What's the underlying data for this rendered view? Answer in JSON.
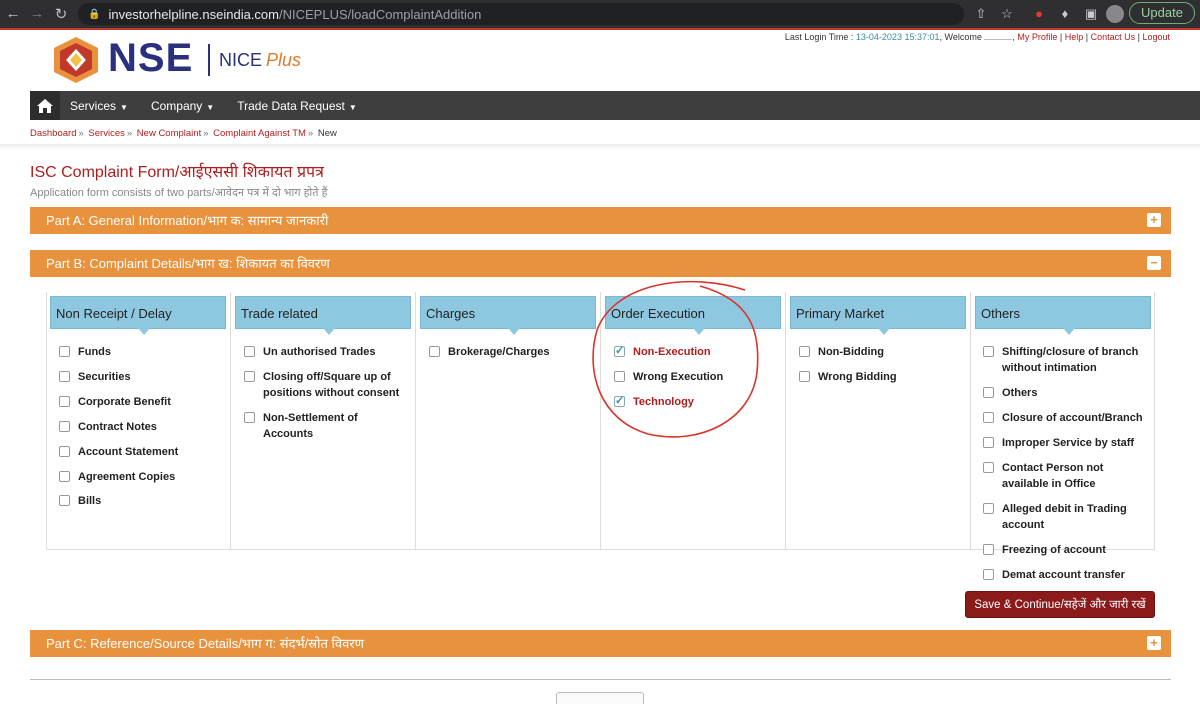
{
  "browser": {
    "url_host": "investorhelpline.nseindia.com",
    "url_path": "/NICEPLUS/loadComplaintAddition",
    "update_label": "Update"
  },
  "header": {
    "logo_text": "NSE",
    "product": "NICE",
    "product_suffix": "Plus",
    "last_login_label": "Last Login Time :",
    "last_login_time": "13-04-2023 15:37:01",
    "welcome": ", Welcome",
    "links": [
      "My Profile",
      "Help",
      "Contact Us",
      "Logout"
    ]
  },
  "nav": {
    "items": [
      "Services",
      "Company",
      "Trade Data Request"
    ]
  },
  "breadcrumb": [
    "Dashboard",
    "Services",
    "New Complaint",
    "Complaint Against TM",
    "New"
  ],
  "form": {
    "title": "ISC Complaint Form/आईएससी शिकायत प्रपत्र",
    "subtitle": "Application form consists of two parts/आवेदन पत्र में दो भाग होते हैं",
    "part_a": "Part A: General Information/भाग क: सामान्य जानकारी",
    "part_b": "Part B: Complaint Details/भाग ख: शिकायत का विवरण",
    "part_c": "Part C: Reference/Source Details/भाग ग: संदर्भ/स्रोत विवरण",
    "save_label": "Save & Continue/सहेजें और जारी रखें"
  },
  "categories": [
    {
      "title": "Non Receipt / Delay",
      "options": [
        {
          "label": "Funds",
          "checked": false
        },
        {
          "label": "Securities",
          "checked": false
        },
        {
          "label": "Corporate Benefit",
          "checked": false
        },
        {
          "label": "Contract Notes",
          "checked": false
        },
        {
          "label": "Account Statement",
          "checked": false
        },
        {
          "label": "Agreement Copies",
          "checked": false
        },
        {
          "label": "Bills",
          "checked": false
        }
      ]
    },
    {
      "title": "Trade related",
      "options": [
        {
          "label": "Un authorised Trades",
          "checked": false
        },
        {
          "label": "Closing off/Square up of positions without consent",
          "checked": false
        },
        {
          "label": "Non-Settlement of Accounts",
          "checked": false
        }
      ]
    },
    {
      "title": "Charges",
      "options": [
        {
          "label": "Brokerage/Charges",
          "checked": false
        }
      ]
    },
    {
      "title": "Order Execution",
      "options": [
        {
          "label": "Non-Execution",
          "checked": true
        },
        {
          "label": "Wrong Execution",
          "checked": false
        },
        {
          "label": "Technology",
          "checked": true
        }
      ]
    },
    {
      "title": "Primary Market",
      "options": [
        {
          "label": "Non-Bidding",
          "checked": false
        },
        {
          "label": "Wrong Bidding",
          "checked": false
        }
      ]
    },
    {
      "title": "Others",
      "options": [
        {
          "label": "Shifting/closure of branch without intimation",
          "checked": false
        },
        {
          "label": "Others",
          "checked": false
        },
        {
          "label": "Closure of account/Branch",
          "checked": false
        },
        {
          "label": "Improper Service by staff",
          "checked": false
        },
        {
          "label": "Contact Person not available in Office",
          "checked": false
        },
        {
          "label": "Alleged debit in Trading account",
          "checked": false
        },
        {
          "label": "Freezing of account",
          "checked": false
        },
        {
          "label": "Demat account transfer",
          "checked": false
        }
      ]
    }
  ]
}
